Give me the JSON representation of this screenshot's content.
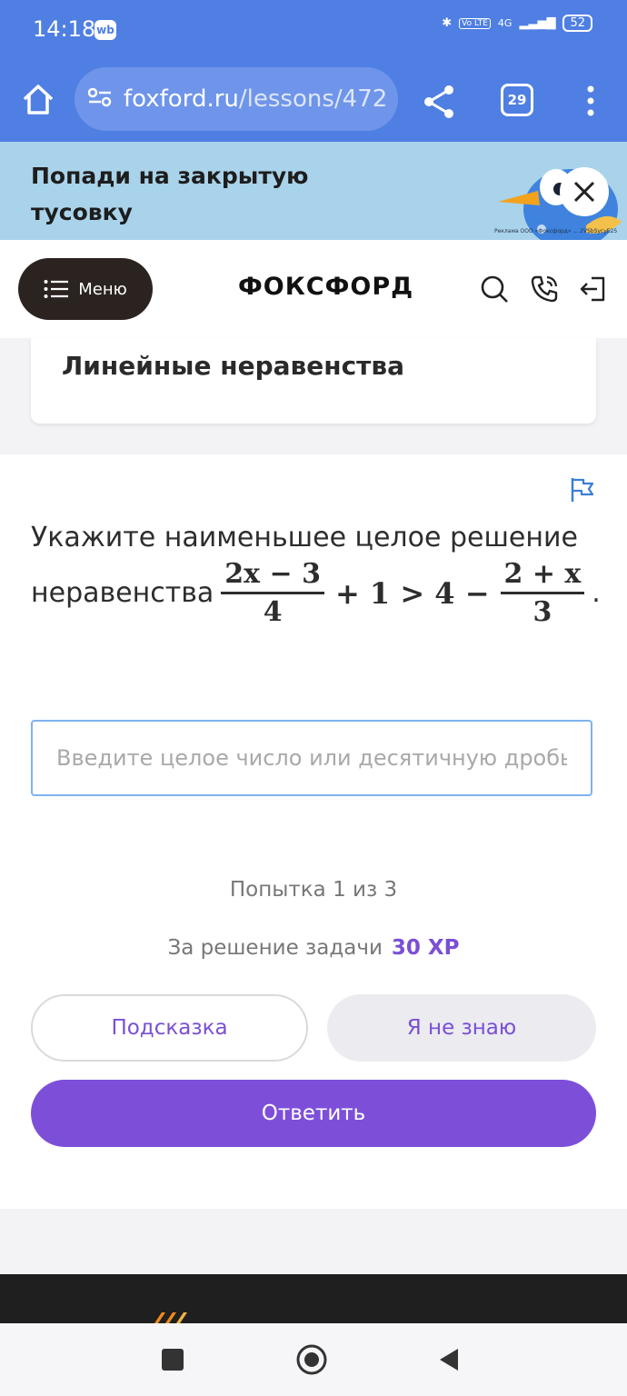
{
  "status_bar": {
    "time": "14:18",
    "app_badge": "wb",
    "network": "4G",
    "volte": "Vo LTE",
    "battery": "52"
  },
  "browser": {
    "url_host": "foxford.ru",
    "url_path": "/lessons/472",
    "tab_count": "29"
  },
  "ad": {
    "title": "Попади на закрытую тусовку",
    "fine_print": "Реклама ООО «Фоксфорд» ... 2VSbSycyE25"
  },
  "header": {
    "menu_label": "Меню",
    "logo": "ФОКСФОРД"
  },
  "lesson": {
    "title": "Линейные неравенства"
  },
  "task": {
    "line1": "Укажите наименьшее целое решение",
    "line2_prefix": "неравенства",
    "frac1_num": "2x − 3",
    "frac1_den": "4",
    "middle": "+ 1 > 4 −",
    "frac2_num": "2 + x",
    "frac2_den": "3",
    "end": "."
  },
  "answer": {
    "placeholder": "Введите целое число или десятичную дробь...",
    "value": ""
  },
  "attempt_text": "Попытка 1 из 3",
  "reward": {
    "label": "За решение задачи",
    "xp": "30 XP"
  },
  "buttons": {
    "hint": "Подсказка",
    "dont_know": "Я не знаю",
    "submit": "Ответить"
  },
  "colors": {
    "browser_blue": "#4f7fe3",
    "accent_purple": "#7d4fd9",
    "ad_bg": "#a9d3ea"
  }
}
